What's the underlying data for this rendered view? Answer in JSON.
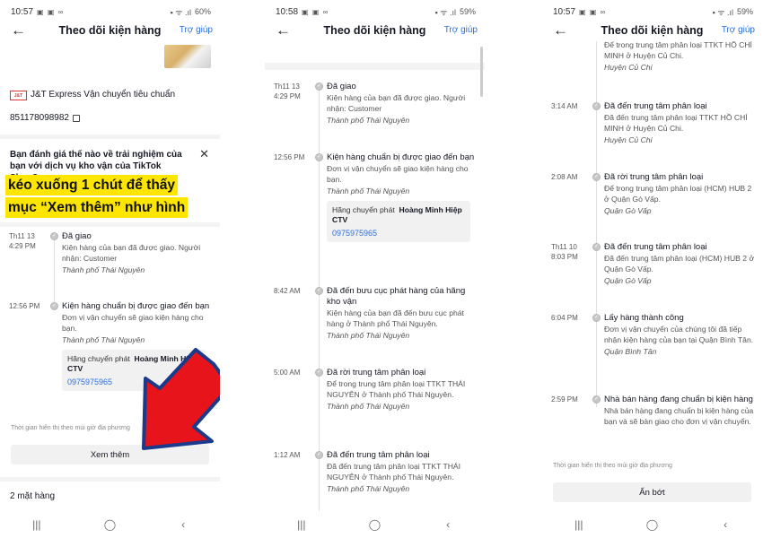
{
  "colors": {
    "accent": "#2d6fd6",
    "highlight": "#ffe600",
    "arrow": "#e8141b",
    "arrow_outline": "#1b3a8a"
  },
  "header": {
    "title": "Theo dõi kiện hàng",
    "help": "Trợ giúp"
  },
  "nav_icons": [
    "menu-icon",
    "home-icon",
    "back-icon"
  ],
  "nav": {
    "recent": "|||",
    "home": "◯",
    "back": "‹"
  },
  "phones": [
    {
      "status": {
        "time": "10:57",
        "battery": "60%"
      },
      "carrier": {
        "name": "J&T Express Vận chuyển tiêu chuẩn",
        "tracking": "851178098982"
      },
      "survey": "Bạn đánh giá thế nào về trải nghiệm của bạn với dịch vụ kho vận của TikTok Shop?",
      "annotation": [
        "kéo xuống 1 chút để thấy",
        "mục “Xem thêm” như hình"
      ],
      "events": [
        {
          "time": "Th11 13\n4:29 PM",
          "title": "Đã giao",
          "desc": "Kiện hàng của bạn đã được giao. Người nhận: Customer",
          "loc": "Thành phố Thái Nguyên"
        },
        {
          "time": "12:56 PM",
          "title": "Kiện hàng chuẩn bị được giao đến bạn",
          "desc": "Đơn vị vận chuyển sẽ giao kiện hàng cho bạn.",
          "loc": "Thành phố Thái Nguyên",
          "carrier_label": "Hãng chuyển phát",
          "carrier_name": "Hoàng Minh Hiệp CTV",
          "phone": "0975975965"
        }
      ],
      "tz_note": "Thời gian hiển thị theo múi giờ địa phương",
      "button": "Xem thêm",
      "item_count": "2 mặt hàng"
    },
    {
      "status": {
        "time": "10:58",
        "battery": "59%"
      },
      "events": [
        {
          "time": "Th11 13\n4:29 PM",
          "title": "Đã giao",
          "desc": "Kiện hàng của bạn đã được giao. Người nhận: Customer",
          "loc": "Thành phố Thái Nguyên"
        },
        {
          "time": "12:56 PM",
          "title": "Kiện hàng chuẩn bị được giao đến bạn",
          "desc": "Đơn vị vận chuyển sẽ giao kiện hàng cho bạn.",
          "loc": "Thành phố Thái Nguyên",
          "carrier_label": "Hãng chuyển phát",
          "carrier_name": "Hoàng Minh Hiệp CTV",
          "phone": "0975975965"
        },
        {
          "time": "8:42 AM",
          "title": "Đã đến bưu cục phát hàng của hãng kho vận",
          "desc": "Kiện hàng của bạn đã đến bưu cục phát hàng ở Thành phố Thái Nguyên.",
          "loc": "Thành phố Thái Nguyên"
        },
        {
          "time": "5:00 AM",
          "title": "Đã rời trung tâm phân loại",
          "desc": "Để trong trung tâm phân loại TTKT THÁI NGUYÊN ở Thành phố Thái Nguyên.",
          "loc": "Thành phố Thái Nguyên"
        },
        {
          "time": "1:12 AM",
          "title": "Đã đến trung tâm phân loại",
          "desc": "Đã đến trung tâm phân loại TTKT THÁI NGUYÊN ở Thành phố Thái Nguyên.",
          "loc": "Thành phố Thái Nguyên"
        }
      ]
    },
    {
      "status": {
        "time": "10:57",
        "battery": "59%"
      },
      "top_partial": {
        "desc": "Để trong trung tâm phân loại TTKT HỒ CHÍ MINH ở Huyện Củ Chi.",
        "loc": "Huyện Củ Chi"
      },
      "events": [
        {
          "time": "3:14 AM",
          "title": "Đã đến trung tâm phân loại",
          "desc": "Đã đến trung tâm phân loại TTKT HỒ CHÍ MINH ở Huyện Củ Chi.",
          "loc": "Huyện Củ Chi"
        },
        {
          "time": "2:08 AM",
          "title": "Đã rời trung tâm phân loại",
          "desc": "Để trong trung tâm phân loại (HCM) HUB 2 ở Quận Gò Vấp.",
          "loc": "Quận Gò Vấp"
        },
        {
          "time": "Th11 10\n8:03 PM",
          "title": "Đã đến trung tâm phân loại",
          "desc": "Đã đến trung tâm phân loại (HCM) HUB 2 ở Quận Gò Vấp.",
          "loc": "Quận Gò Vấp"
        },
        {
          "time": "6:04 PM",
          "title": "Lấy hàng thành công",
          "desc": "Đơn vị vận chuyển của chúng tôi đã tiếp nhận kiện hàng của bạn tại Quận Bình Tân.",
          "loc": "Quận Bình Tân"
        },
        {
          "time": "2:59 PM",
          "title": "Nhà bán hàng đang chuẩn bị kiện hàng",
          "desc": "Nhà bán hàng đang chuẩn bị kiện hàng của bạn và sẽ bàn giao cho đơn vị vận chuyển.",
          "loc": ""
        }
      ],
      "tz_note": "Thời gian hiển thị theo múi giờ địa phương",
      "button": "Ẩn bớt"
    }
  ]
}
